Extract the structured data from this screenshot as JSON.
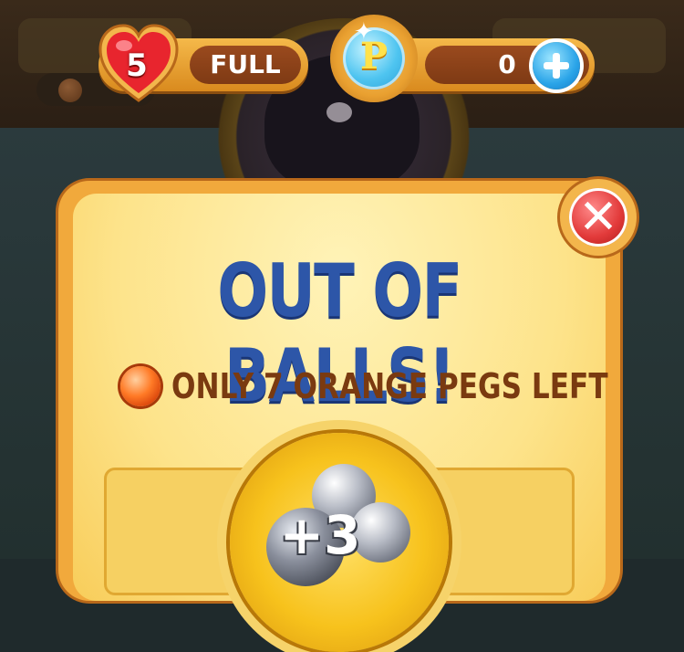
{
  "hud": {
    "lives": {
      "count": "5",
      "status": "FULL"
    },
    "currency": {
      "coin_letter": "P",
      "amount": "0",
      "add_icon": "plus-icon"
    }
  },
  "modal": {
    "title": "OUT OF BALLS!",
    "pegs_left_text": "ONLY 7 ORANGE PEGS LEFT",
    "offer": {
      "amount": "+3",
      "item_icon": "silver-balls-icon"
    },
    "close_icon": "close-icon"
  },
  "colors": {
    "title_blue": "#2d56a8",
    "panel_yellow": "#fde38a",
    "frame_orange": "#f1a93c",
    "peg_orange": "#ff7a26",
    "close_red": "#e23a3a",
    "plus_blue": "#2aa4e8"
  }
}
